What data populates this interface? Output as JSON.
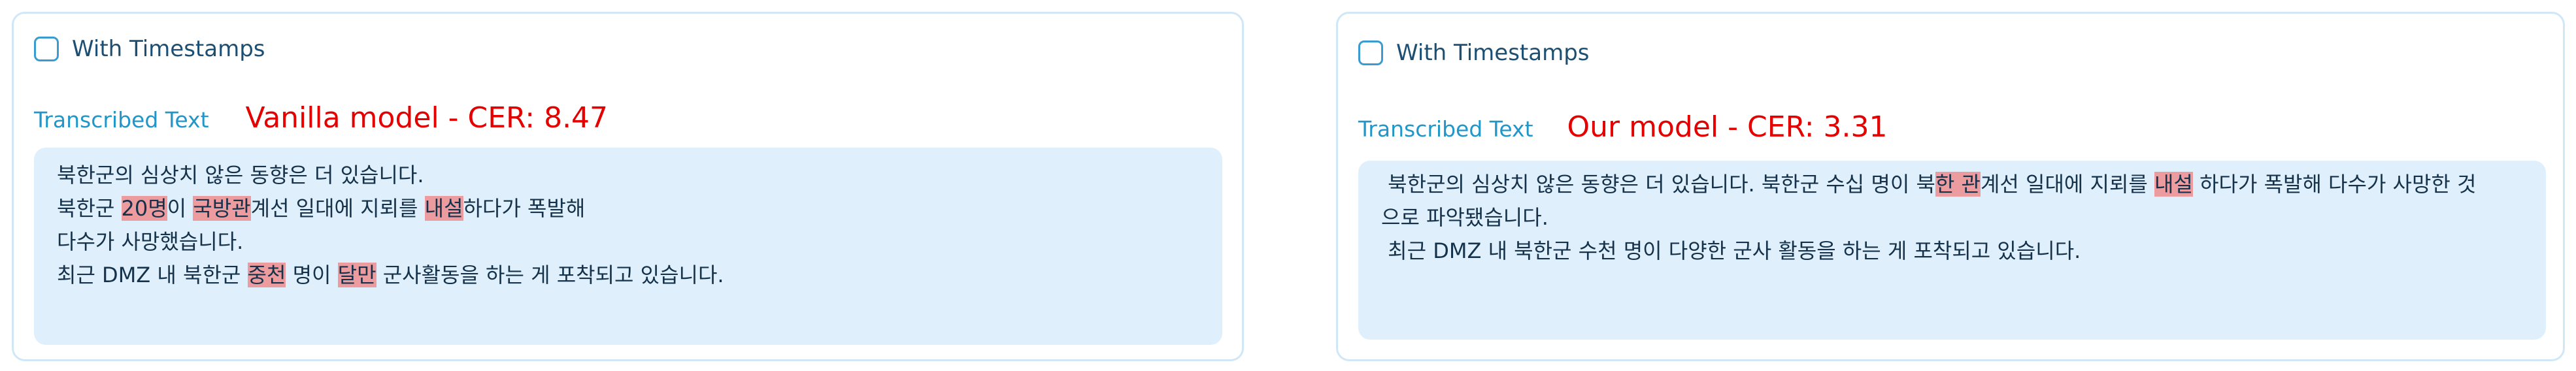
{
  "panels": [
    {
      "checkbox_label": "With Timestamps",
      "section_label": "Transcribed Text",
      "model_label": "Vanilla model - CER: 8.47",
      "lines": [
        [
          {
            "t": "북한군의 심상치 않은 동향은 더 있습니다.",
            "h": false
          }
        ],
        [
          {
            "t": "북한군 ",
            "h": false
          },
          {
            "t": "20명",
            "h": true
          },
          {
            "t": "이 ",
            "h": false
          },
          {
            "t": "국방관",
            "h": true
          },
          {
            "t": "계선 일대에 지뢰를 ",
            "h": false
          },
          {
            "t": "내설",
            "h": true
          },
          {
            "t": "하다가 폭발해",
            "h": false
          }
        ],
        [
          {
            "t": "다수가 사망했습니다.",
            "h": false
          }
        ],
        [
          {
            "t": "최근 DMZ 내 북한군 ",
            "h": false
          },
          {
            "t": "중천",
            "h": true
          },
          {
            "t": " 명이 ",
            "h": false
          },
          {
            "t": "달만",
            "h": true
          },
          {
            "t": " 군사활동을 하는 게 포착되고 있습니다.",
            "h": false
          }
        ]
      ]
    },
    {
      "checkbox_label": "With Timestamps",
      "section_label": "Transcribed Text",
      "model_label": "Our model - CER: 3.31",
      "lines": [
        [
          {
            "t": " 북한군의 심상치 않은 동향은 더 있습니다. 북한군 수십 명이 북",
            "h": false
          },
          {
            "t": "한 관",
            "h": true
          },
          {
            "t": "계선 일대에 지뢰를 ",
            "h": false
          },
          {
            "t": "내설",
            "h": true
          },
          {
            "t": " 하다가 폭발해 다수가 사망한 것",
            "h": false
          }
        ],
        [
          {
            "t": "으로 파악됐습니다.",
            "h": false
          }
        ],
        [
          {
            "t": " 최근 DMZ 내 북한군 수천 명이 다양한 군사 활동을 하는 게 포착되고 있습니다.",
            "h": false
          }
        ]
      ]
    }
  ],
  "colors": {
    "highlight": "#ec9b9f",
    "model_label": "#e50000",
    "section_label": "#2196c9",
    "text_box_bg": "#dff0fc",
    "panel_border": "#cfe7f7"
  }
}
